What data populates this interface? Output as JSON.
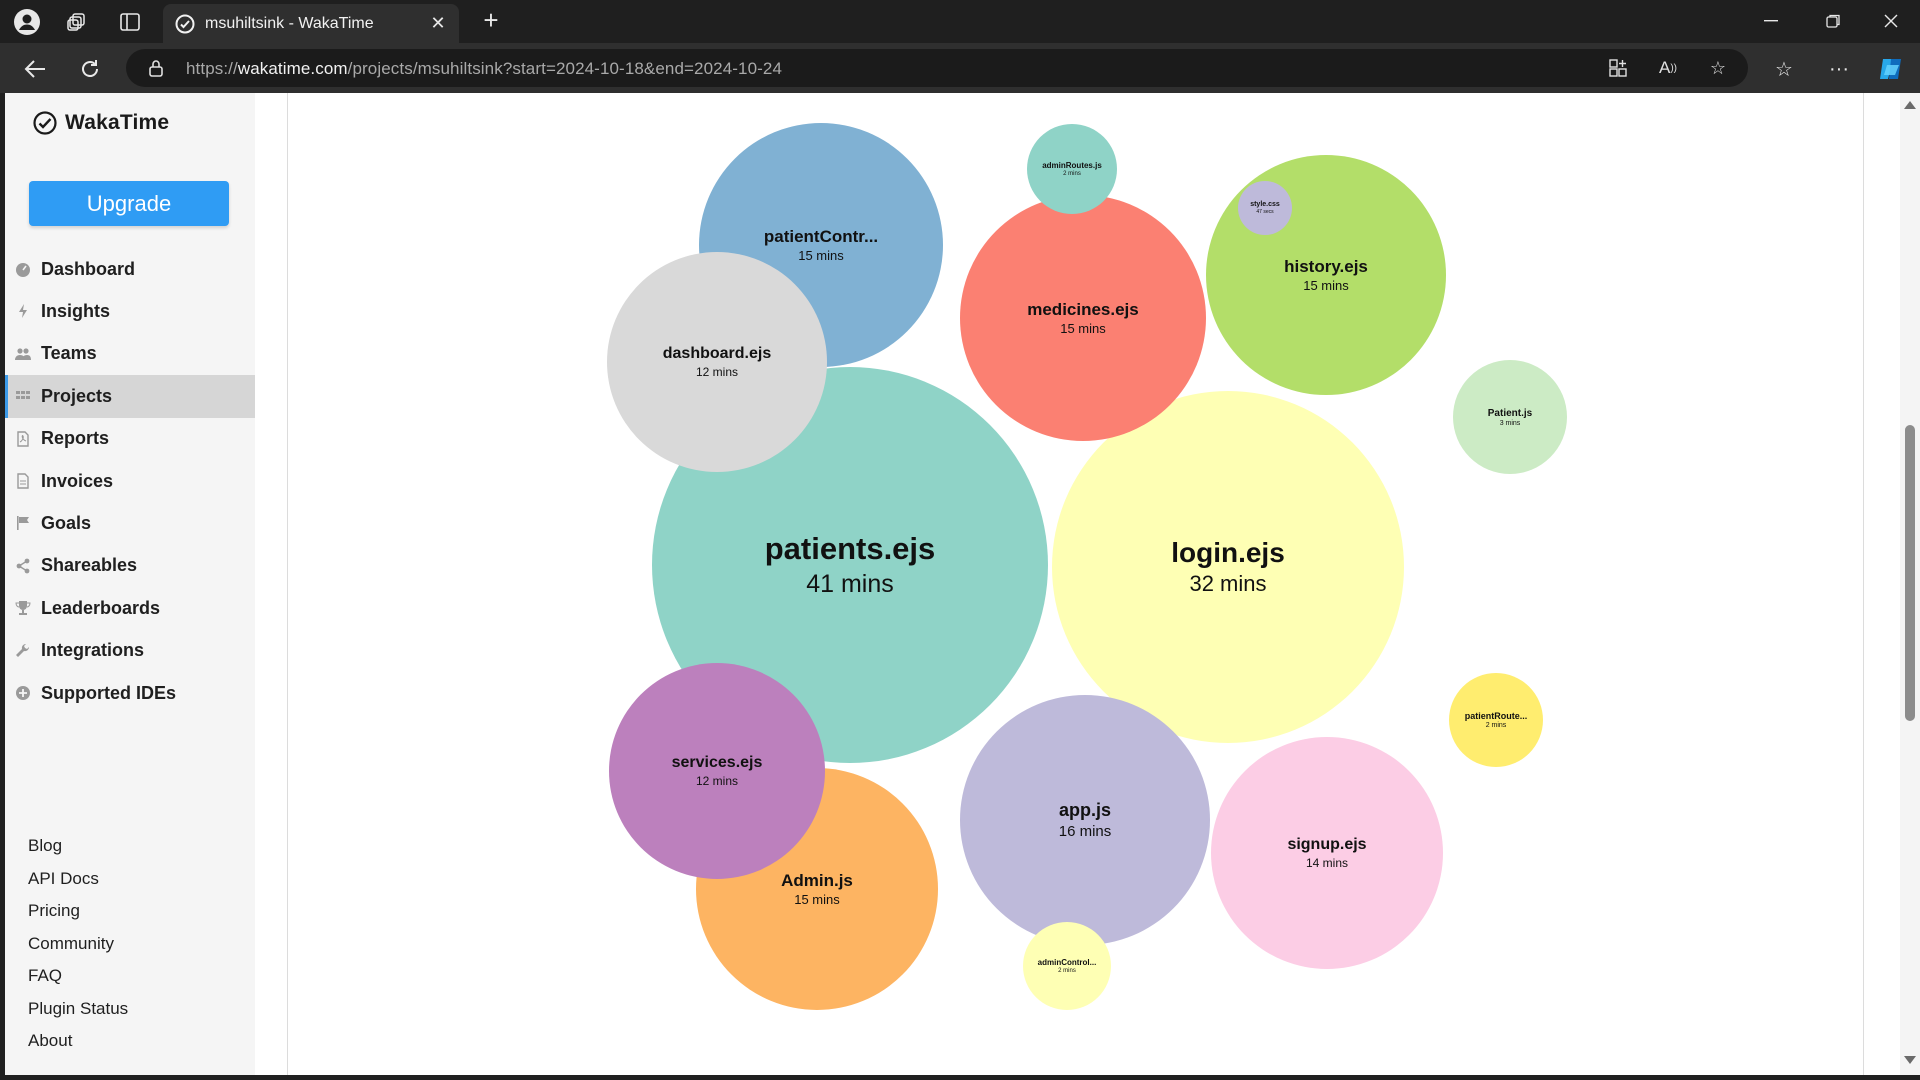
{
  "browser": {
    "tab_title": "msuhiltsink - WakaTime",
    "url_prefix": "https://",
    "url_host": "wakatime.com",
    "url_path": "/projects/msuhiltsink?start=2024-10-18&end=2024-10-24"
  },
  "sidebar": {
    "brand": "WakaTime",
    "upgrade_label": "Upgrade",
    "items": [
      {
        "label": "Dashboard",
        "icon": "dashboard-icon"
      },
      {
        "label": "Insights",
        "icon": "bolt-icon"
      },
      {
        "label": "Teams",
        "icon": "users-icon"
      },
      {
        "label": "Projects",
        "icon": "grid-icon",
        "active": true
      },
      {
        "label": "Reports",
        "icon": "pdf-icon"
      },
      {
        "label": "Invoices",
        "icon": "file-icon"
      },
      {
        "label": "Goals",
        "icon": "flag-icon"
      },
      {
        "label": "Shareables",
        "icon": "share-icon"
      },
      {
        "label": "Leaderboards",
        "icon": "trophy-icon"
      },
      {
        "label": "Integrations",
        "icon": "wrench-icon"
      },
      {
        "label": "Supported IDEs",
        "icon": "plus-circle-icon"
      }
    ],
    "footer_links": [
      "Blog",
      "API Docs",
      "Pricing",
      "Community",
      "FAQ",
      "Plugin Status",
      "About"
    ]
  },
  "files": [
    {
      "name": "patients.ejs",
      "duration": "41 mins",
      "color": "#8fd3c7"
    },
    {
      "name": "login.ejs",
      "duration": "32 mins",
      "color": "#feffb4"
    },
    {
      "name": "app.js",
      "duration": "16 mins",
      "color": "#bebada"
    },
    {
      "name": "patientContr...",
      "duration": "15 mins",
      "color": "#80b1d3"
    },
    {
      "name": "medicines.ejs",
      "duration": "15 mins",
      "color": "#fb8072"
    },
    {
      "name": "history.ejs",
      "duration": "15 mins",
      "color": "#b3de69"
    },
    {
      "name": "Admin.js",
      "duration": "15 mins",
      "color": "#fdb462"
    },
    {
      "name": "signup.ejs",
      "duration": "14 mins",
      "color": "#fccde5"
    },
    {
      "name": "dashboard.ejs",
      "duration": "12 mins",
      "color": "#d9d9d9"
    },
    {
      "name": "services.ejs",
      "duration": "12 mins",
      "color": "#bc80bd"
    },
    {
      "name": "Patient.js",
      "duration": "3 mins",
      "color": "#ccebc5"
    },
    {
      "name": "adminRoutes.js",
      "duration": "2 mins",
      "color": "#8fd3c7"
    },
    {
      "name": "patientRoute...",
      "duration": "2 mins",
      "color": "#ffed6f"
    },
    {
      "name": "adminControl...",
      "duration": "2 mins",
      "color": "#feffb4"
    },
    {
      "name": "style.css",
      "duration": "47 secs",
      "color": "#bebada"
    }
  ]
}
